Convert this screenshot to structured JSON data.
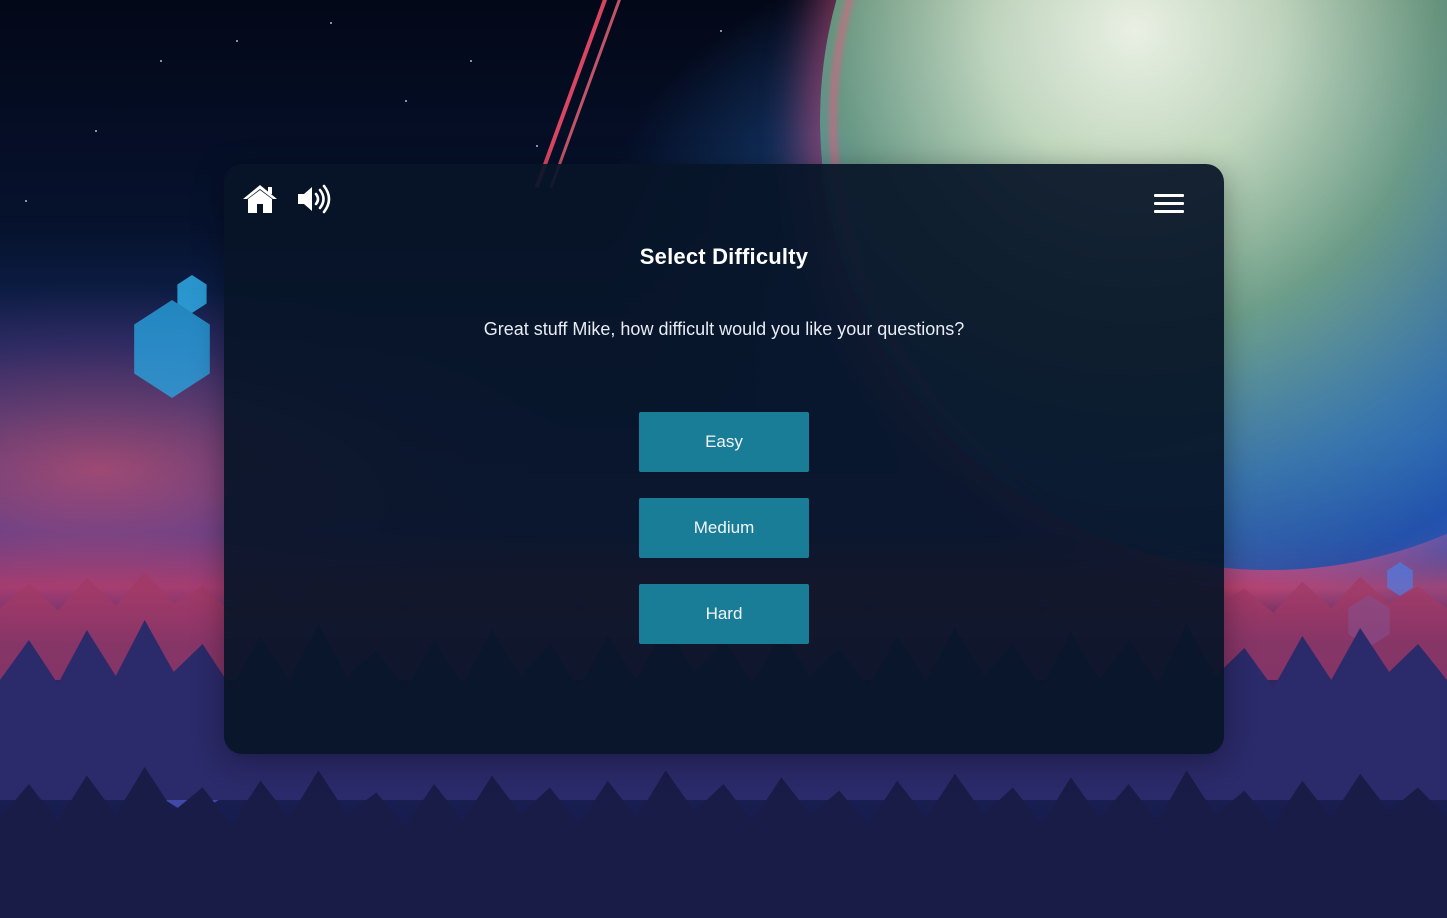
{
  "toolbar": {
    "home_icon": "home-icon",
    "sound_icon": "speaker-volume-icon",
    "menu_icon": "hamburger-menu-icon"
  },
  "screen": {
    "title": "Select Difficulty",
    "prompt": "Great stuff Mike, how difficult would you like your questions?"
  },
  "difficulty": {
    "options": [
      {
        "label": "Easy"
      },
      {
        "label": "Medium"
      },
      {
        "label": "Hard"
      }
    ]
  },
  "colors": {
    "card_background": "#08142a",
    "button_background": "#1a7d98",
    "text": "#ffffff"
  }
}
